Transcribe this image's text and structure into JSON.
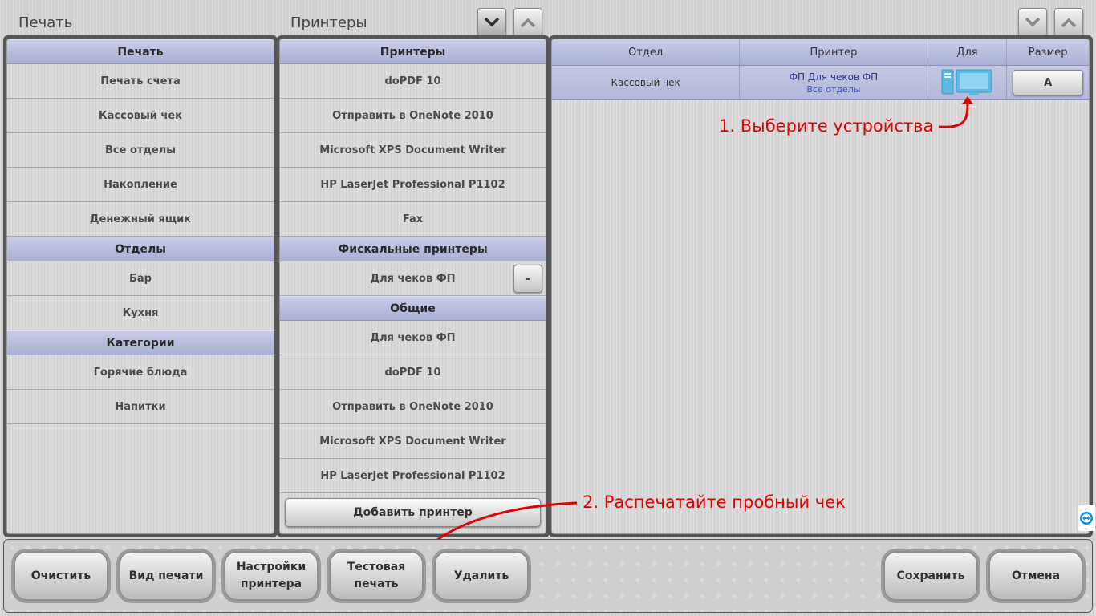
{
  "top": {
    "left_title": "Печать",
    "mid_title": "Принтеры"
  },
  "left_panel": {
    "sections": [
      {
        "header": "Печать",
        "items": [
          "Печать счета",
          "Кассовый чек",
          "Все отделы",
          "Накопление",
          "Денежный ящик"
        ]
      },
      {
        "header": "Отделы",
        "items": [
          "Бар",
          "Кухня"
        ]
      },
      {
        "header": "Категории",
        "items": [
          "Горячие блюда",
          "Напитки"
        ]
      }
    ]
  },
  "mid_panel": {
    "printers_header": "Принтеры",
    "printers": [
      "doPDF 10",
      "Отправить в OneNote 2010",
      "Microsoft XPS Document Writer",
      "HP LaserJet Professional P1102",
      "Fax"
    ],
    "fiscal_header": "Фискальные принтеры",
    "fiscal": [
      "Для чеков ФП"
    ],
    "fiscal_remove_label": "-",
    "common_header": "Общие",
    "common": [
      "Для чеков ФП",
      "doPDF 10",
      "Отправить в OneNote 2010",
      "Microsoft XPS Document Writer",
      "HP LaserJet Professional P1102"
    ],
    "add_button": "Добавить принтер"
  },
  "right_panel": {
    "columns": [
      "Отдел",
      "Принтер",
      "Для",
      "Размер"
    ],
    "rows": [
      {
        "department": "Кассовый чек",
        "printer": "ФП Для чеков ФП",
        "printer_sub": "Все отделы",
        "for_icon": "monitor-computer-icon",
        "size": "A"
      }
    ]
  },
  "annotations": {
    "step1": "1. Выберите устройства",
    "step2": "2. Распечатайте пробный чек",
    "color": "#e30000"
  },
  "bottom": {
    "clear": "Очистить",
    "print_view": "Вид печати",
    "printer_settings_1": "Настройки",
    "printer_settings_2": "принтера",
    "test_print_1": "Тестовая",
    "test_print_2": "печать",
    "delete": "Удалить",
    "save": "Сохранить",
    "cancel": "Отмена"
  },
  "colors": {
    "header_blue": "#aab0d6",
    "link_blue": "#3a4fc0",
    "icon_cyan": "#4ab3e0"
  }
}
